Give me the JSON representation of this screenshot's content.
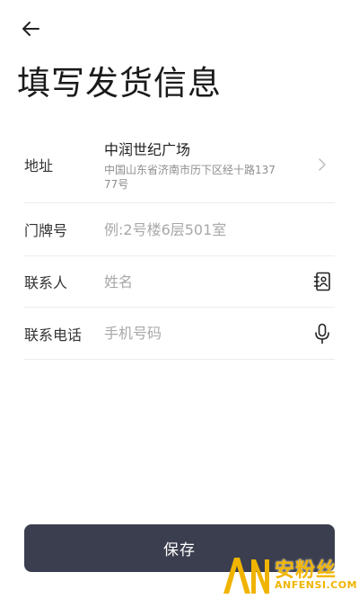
{
  "header": {
    "back_icon": "arrow-left-icon",
    "title": "填写发货信息"
  },
  "form": {
    "address": {
      "label": "地址",
      "name": "中润世纪广场",
      "detail": "中国山东省济南市历下区经十路13777号",
      "chevron_icon": "chevron-right-icon"
    },
    "door": {
      "label": "门牌号",
      "value": "",
      "placeholder": "例:2号楼6层501室"
    },
    "contact": {
      "label": "联系人",
      "value": "",
      "placeholder": "姓名",
      "icon": "contact-book-icon"
    },
    "phone": {
      "label": "联系电话",
      "value": "",
      "placeholder": "手机号码",
      "icon": "microphone-icon"
    }
  },
  "footer": {
    "save_label": "保存"
  },
  "watermark": {
    "logo_text": "AN",
    "name_cn": "安粉丝",
    "name_en": "ANFENSI.COM"
  },
  "colors": {
    "button_bg": "#3b3e4f",
    "button_text": "#ffffff",
    "placeholder": "#a8a8a8",
    "divider": "#ececec",
    "watermark": "#f0b400"
  }
}
